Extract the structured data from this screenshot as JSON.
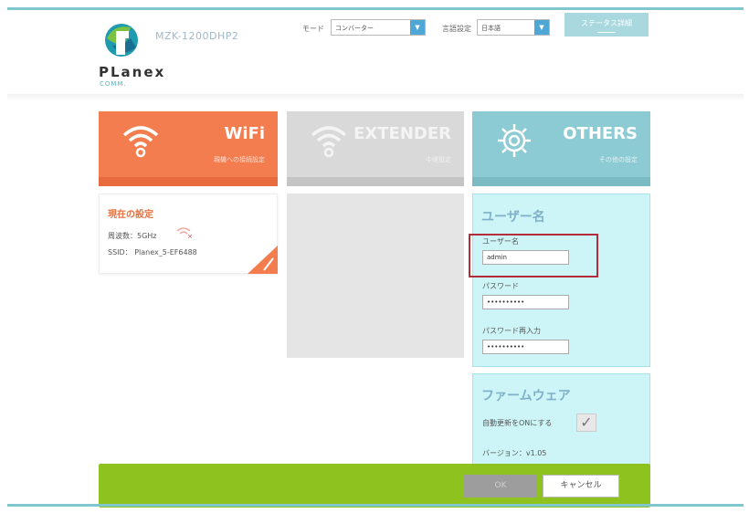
{
  "header": {
    "model": "MZK-1200DHP2",
    "brand": "PLanex",
    "brand_sub": "COMM.",
    "mode_label": "モード",
    "mode_value": "コンバーター",
    "lang_label": "言語設定",
    "lang_value": "日本語",
    "status_button": "ステータス詳細"
  },
  "tiles": {
    "wifi": {
      "title": "WiFi",
      "sub": "親機への接続設定",
      "color": "#f47d4f"
    },
    "extender": {
      "title": "EXTENDER",
      "sub": "中継設定",
      "color": "#d9d9d9"
    },
    "others": {
      "title": "OTHERS",
      "sub": "その他の設定",
      "color": "#8ccbd3"
    }
  },
  "current": {
    "title": "現在の設定",
    "frequency": "周波数：5GHz",
    "ssid": "SSID： Planex_5-EF6488"
  },
  "user": {
    "title": "ユーザー名",
    "username_label": "ユーザー名",
    "username_value": "admin",
    "password_label": "パスワード",
    "password_value": "••••••••••",
    "password_confirm_label": "パスワード再入力",
    "password_confirm_value": "••••••••••"
  },
  "firmware": {
    "title": "ファームウェア",
    "auto_update_label": "自動更新をONにする",
    "version": "バージョン：v1.05"
  },
  "footer": {
    "ok_label": "OK",
    "cancel_label": "キャンセル"
  },
  "colors": {
    "accent_green": "#8ec21f",
    "highlight_red": "#b52d3a",
    "panel_cyan": "#cdf5f8"
  }
}
